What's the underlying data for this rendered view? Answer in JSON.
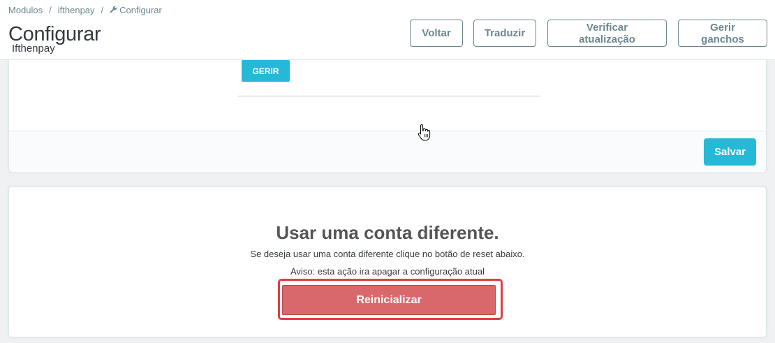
{
  "breadcrumb": {
    "items": [
      "Modulos",
      "ifthenpay",
      "Configurar"
    ],
    "separator": "/",
    "current_icon": "wrench-icon"
  },
  "header": {
    "title": "Configurar",
    "subtitle": "Ifthenpay"
  },
  "toolbar": {
    "back_label": "Voltar",
    "translate_label": "Traduzir",
    "check_update_label": "Verificar atualização",
    "manage_hooks_label": "Gerir ganchos"
  },
  "config_card": {
    "manage_label": "GERIR",
    "save_label": "Salvar"
  },
  "reset_card": {
    "heading": "Usar uma conta diferente.",
    "description": "Se deseja usar uma conta diferente clique no botão de reset abaixo.",
    "warning": "Aviso: esta ação ira apagar a configuração atual",
    "reset_label": "Reinicializar"
  },
  "colors": {
    "primary": "#25b9d7",
    "danger": "#d9686c",
    "highlight": "#e33d42",
    "text": "#363a41",
    "muted": "#6c868e"
  }
}
